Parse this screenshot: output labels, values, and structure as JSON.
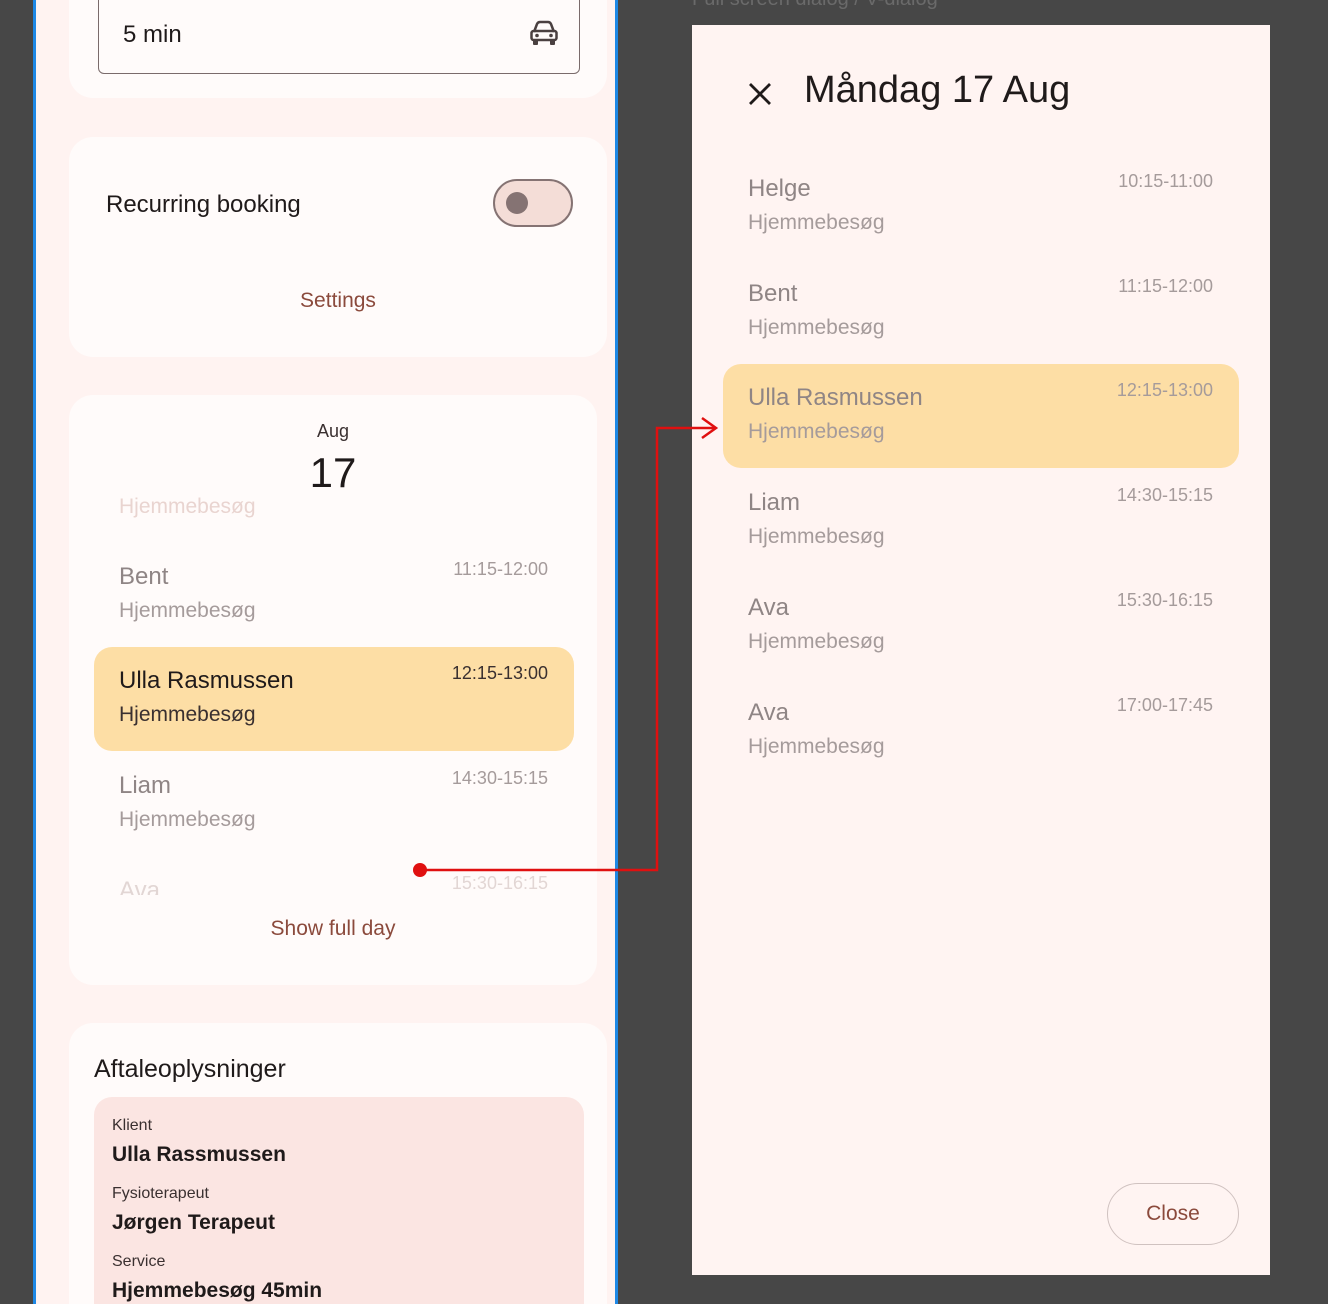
{
  "travel": {
    "value": "5 min",
    "icon": "car-icon"
  },
  "recurring": {
    "label": "Recurring booking",
    "enabled": false,
    "settings_label": "Settings"
  },
  "day_preview": {
    "month": "Aug",
    "day": "17",
    "top_faded_service": "Hjemmebesøg",
    "appointments": [
      {
        "name": "Bent",
        "service": "Hjemmebesøg",
        "time": "11:15-12:00"
      },
      {
        "name": "Ulla Rasmussen",
        "service": "Hjemmebesøg",
        "time": "12:15-13:00",
        "selected": true
      },
      {
        "name": "Liam",
        "service": "Hjemmebesøg",
        "time": "14:30-15:15"
      },
      {
        "name": "Ava",
        "time": "15:30-16:15"
      }
    ],
    "show_full_label": "Show full day"
  },
  "info": {
    "title": "Aftaleoplysninger",
    "client_label": "Klient",
    "client_value": "Ulla Rassmussen",
    "therapist_label": "Fysioterapeut",
    "therapist_value": "Jørgen Terapeut",
    "service_label": "Service",
    "service_value": "Hjemmebesøg 45min"
  },
  "dialog": {
    "caption": "Full screen dialog / V-dialog",
    "title": "Måndag 17 Aug",
    "appointments": [
      {
        "name": "Helge",
        "service": "Hjemmebesøg",
        "time": "10:15-11:00"
      },
      {
        "name": "Bent",
        "service": "Hjemmebesøg",
        "time": "11:15-12:00"
      },
      {
        "name": "Ulla Rasmussen",
        "service": "Hjemmebesøg",
        "time": "12:15-13:00",
        "selected": true
      },
      {
        "name": "Liam",
        "service": "Hjemmebesøg",
        "time": "14:30-15:15"
      },
      {
        "name": "Ava",
        "service": "Hjemmebesøg",
        "time": "15:30-16:15"
      },
      {
        "name": "Ava",
        "service": "Hjemmebesøg",
        "time": "17:00-17:45"
      }
    ],
    "close_label": "Close"
  },
  "colors": {
    "accent": "#8b4a3c",
    "selected": "#fddea5",
    "connector": "#e01010",
    "frame": "#1e88e5"
  }
}
